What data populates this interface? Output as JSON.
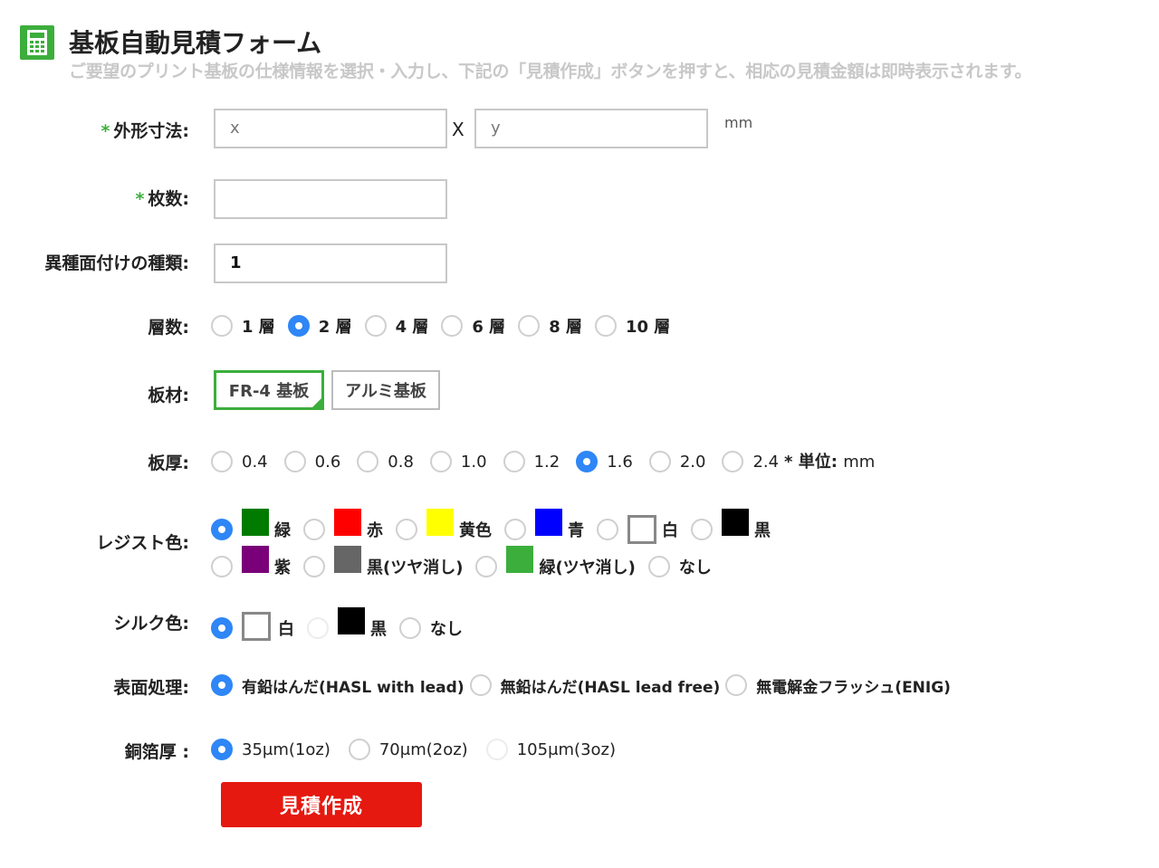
{
  "header": {
    "title": "基板自動見積フォーム",
    "subtitle": "ご要望のプリント基板の仕様情報を選択・入力し、下記の「見積作成」ボタンを押すと、相応の見積金額は即時表示されます。"
  },
  "form": {
    "required_mark": "*",
    "dimensions": {
      "label": "外形寸法:",
      "x_placeholder": "x",
      "times": "X",
      "y_placeholder": "y",
      "unit": "mm"
    },
    "quantity": {
      "label": "枚数:",
      "value": ""
    },
    "variety": {
      "label": "異種面付けの種類:",
      "value": "1"
    },
    "layers": {
      "label": "層数:",
      "selected": "2 層",
      "options": [
        "1 層",
        "2 層",
        "4 層",
        "6 層",
        "8 層",
        "10 層"
      ]
    },
    "material": {
      "label": "板材:",
      "selected": "FR-4 基板",
      "options": [
        "FR-4 基板",
        "アルミ基板"
      ]
    },
    "thickness": {
      "label": "板厚:",
      "selected": "1.6",
      "options": [
        "0.4",
        "0.6",
        "0.8",
        "1.0",
        "1.2",
        "1.6",
        "2.0",
        "2.4"
      ],
      "note_mark": "*",
      "note_label": "単位:",
      "note_unit": "mm"
    },
    "resist_color": {
      "label": "レジスト色:",
      "selected": "緑",
      "options": [
        {
          "label": "緑",
          "color": "#007b00"
        },
        {
          "label": "赤",
          "color": "#ff0000"
        },
        {
          "label": "黄色",
          "color": "#ffff00"
        },
        {
          "label": "青",
          "color": "#0000ff"
        },
        {
          "label": "白",
          "color": "#ffffff"
        },
        {
          "label": "黒",
          "color": "#000000"
        },
        {
          "label": "紫",
          "color": "#7a007a"
        },
        {
          "label": "黒(ツヤ消し)",
          "color": "#666666"
        },
        {
          "label": "緑(ツヤ消し)",
          "color": "#3cae3c"
        },
        {
          "label": "なし",
          "color": ""
        }
      ]
    },
    "silk_color": {
      "label": "シルク色:",
      "selected": "白",
      "options": [
        {
          "label": "白",
          "color": "#ffffff"
        },
        {
          "label": "黒",
          "color": "#000000"
        },
        {
          "label": "なし",
          "color": ""
        }
      ]
    },
    "surface": {
      "label": "表面処理:",
      "selected": "有鉛はんだ(HASL with lead)",
      "options": [
        "有鉛はんだ(HASL with lead)",
        "無鉛はんだ(HASL lead free)",
        "無電解金フラッシュ(ENIG)"
      ]
    },
    "copper": {
      "label": "銅箔厚 :",
      "selected": "35μm(1oz)",
      "options": [
        "35μm(1oz)",
        "70μm(2oz)",
        "105μm(3oz)"
      ]
    },
    "submit_label": "見積作成"
  },
  "colors": {
    "accent_green": "#3cae3c",
    "radio_blue": "#2f86f6",
    "submit_red": "#e5190f"
  }
}
